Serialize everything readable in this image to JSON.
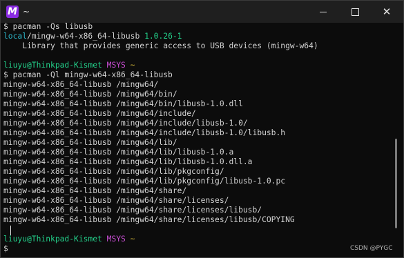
{
  "window": {
    "title": "~",
    "app_icon_letter": "M",
    "app_icon_color": "#8a2be2",
    "minimize_glyph": "—",
    "maximize_glyph": "□",
    "close_glyph": "✕"
  },
  "terminal": {
    "lines": [
      {
        "segments": [
          {
            "text": "$ pacman -Qs libusb",
            "color": "white"
          }
        ]
      },
      {
        "segments": [
          {
            "text": "local",
            "color": "cyan"
          },
          {
            "text": "/mingw-w64-x86_64-libusb ",
            "color": "white"
          },
          {
            "text": "1.0.26-1",
            "color": "green"
          }
        ]
      },
      {
        "segments": [
          {
            "text": "    Library that provides generic access to USB devices (mingw-w64)",
            "color": "white"
          }
        ]
      },
      {
        "segments": [
          {
            "text": "",
            "color": "white"
          }
        ]
      },
      {
        "segments": [
          {
            "text": "liuyu@Thinkpad-Kismet",
            "color": "green"
          },
          {
            "text": " ",
            "color": "white"
          },
          {
            "text": "MSYS",
            "color": "magenta"
          },
          {
            "text": " ",
            "color": "white"
          },
          {
            "text": "~",
            "color": "yellow"
          }
        ]
      },
      {
        "segments": [
          {
            "text": "$ pacman -Ql mingw-w64-x86_64-libusb",
            "color": "white"
          }
        ]
      },
      {
        "segments": [
          {
            "text": "mingw-w64-x86_64-libusb /mingw64/",
            "color": "white"
          }
        ]
      },
      {
        "segments": [
          {
            "text": "mingw-w64-x86_64-libusb /mingw64/bin/",
            "color": "white"
          }
        ]
      },
      {
        "segments": [
          {
            "text": "mingw-w64-x86_64-libusb /mingw64/bin/libusb-1.0.dll",
            "color": "white"
          }
        ]
      },
      {
        "segments": [
          {
            "text": "mingw-w64-x86_64-libusb /mingw64/include/",
            "color": "white"
          }
        ]
      },
      {
        "segments": [
          {
            "text": "mingw-w64-x86_64-libusb /mingw64/include/libusb-1.0/",
            "color": "white"
          }
        ]
      },
      {
        "segments": [
          {
            "text": "mingw-w64-x86_64-libusb /mingw64/include/libusb-1.0/libusb.h",
            "color": "white"
          }
        ]
      },
      {
        "segments": [
          {
            "text": "mingw-w64-x86_64-libusb /mingw64/lib/",
            "color": "white"
          }
        ]
      },
      {
        "segments": [
          {
            "text": "mingw-w64-x86_64-libusb /mingw64/lib/libusb-1.0.a",
            "color": "white"
          }
        ]
      },
      {
        "segments": [
          {
            "text": "mingw-w64-x86_64-libusb /mingw64/lib/libusb-1.0.dll.a",
            "color": "white"
          }
        ]
      },
      {
        "segments": [
          {
            "text": "mingw-w64-x86_64-libusb /mingw64/lib/pkgconfig/",
            "color": "white"
          }
        ]
      },
      {
        "segments": [
          {
            "text": "mingw-w64-x86_64-libusb /mingw64/lib/pkgconfig/libusb-1.0.pc",
            "color": "white"
          }
        ]
      },
      {
        "segments": [
          {
            "text": "mingw-w64-x86_64-libusb /mingw64/share/",
            "color": "white"
          }
        ]
      },
      {
        "segments": [
          {
            "text": "mingw-w64-x86_64-libusb /mingw64/share/licenses/",
            "color": "white"
          }
        ]
      },
      {
        "segments": [
          {
            "text": "mingw-w64-x86_64-libusb /mingw64/share/licenses/libusb/",
            "color": "white"
          }
        ]
      },
      {
        "segments": [
          {
            "text": "mingw-w64-x86_64-libusb /mingw64/share/licenses/libusb/COPYING",
            "color": "white"
          }
        ]
      },
      {
        "segments": [
          {
            "text": "",
            "color": "white"
          }
        ]
      },
      {
        "segments": [
          {
            "text": "liuyu@Thinkpad-Kismet",
            "color": "green"
          },
          {
            "text": " ",
            "color": "white"
          },
          {
            "text": "MSYS",
            "color": "magenta"
          },
          {
            "text": " ",
            "color": "white"
          },
          {
            "text": "~",
            "color": "yellow"
          }
        ]
      },
      {
        "segments": [
          {
            "text": "$ ",
            "color": "white"
          }
        ]
      }
    ]
  },
  "colors": {
    "cyan": "#2bb3c6",
    "green": "#23d18b",
    "white": "#d4d4d4",
    "magenta": "#c84dd3",
    "yellow": "#d7ba3b"
  },
  "watermark": "CSDN @PYGC"
}
